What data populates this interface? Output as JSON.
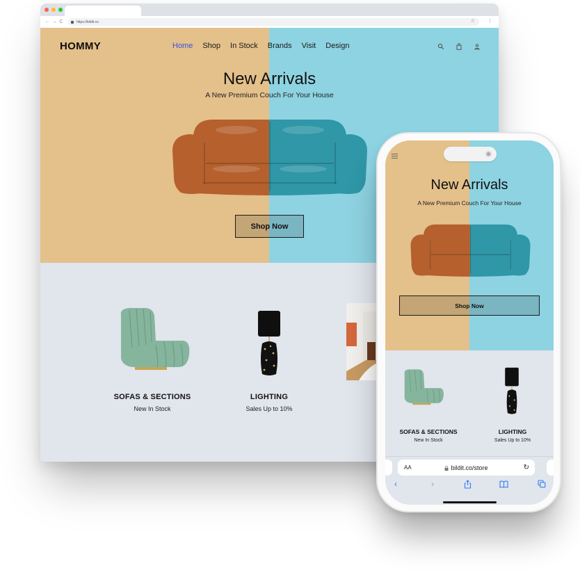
{
  "desktop_browser": {
    "address": "https://bildit.co",
    "nav_back": "←",
    "nav_forward": "→",
    "reload": "C",
    "star": "☆",
    "menu": "⋮"
  },
  "site": {
    "logo": "HOMMY",
    "nav": [
      {
        "label": "Home",
        "active": true
      },
      {
        "label": "Shop"
      },
      {
        "label": "In Stock"
      },
      {
        "label": "Brands"
      },
      {
        "label": "Visit"
      },
      {
        "label": "Design"
      }
    ],
    "icons": [
      "search-icon",
      "shopping-bag-icon",
      "account-icon"
    ],
    "hero": {
      "title": "New Arrivals",
      "subtitle": "A New Premium Couch For Your House",
      "cta": "Shop Now"
    },
    "categories": [
      {
        "title": "SOFAS & SECTIONS",
        "subtitle": "New In Stock"
      },
      {
        "title": "LIGHTING",
        "subtitle": "Sales Up to 10%"
      }
    ],
    "colors": {
      "hero_left": "#e4c08a",
      "hero_right": "#8ed3e2",
      "categories_bg": "#e1e5ec",
      "nav_active": "#3b4fe0"
    }
  },
  "phone": {
    "url": "bildit.co/store",
    "aa": "AA",
    "reload": "↻",
    "toolbar": [
      "back-icon",
      "forward-icon",
      "share-icon",
      "bookmarks-icon",
      "tabs-icon"
    ],
    "toolbar_glyphs": [
      "‹",
      "›",
      "⇪",
      "⊞",
      "⧉"
    ]
  }
}
